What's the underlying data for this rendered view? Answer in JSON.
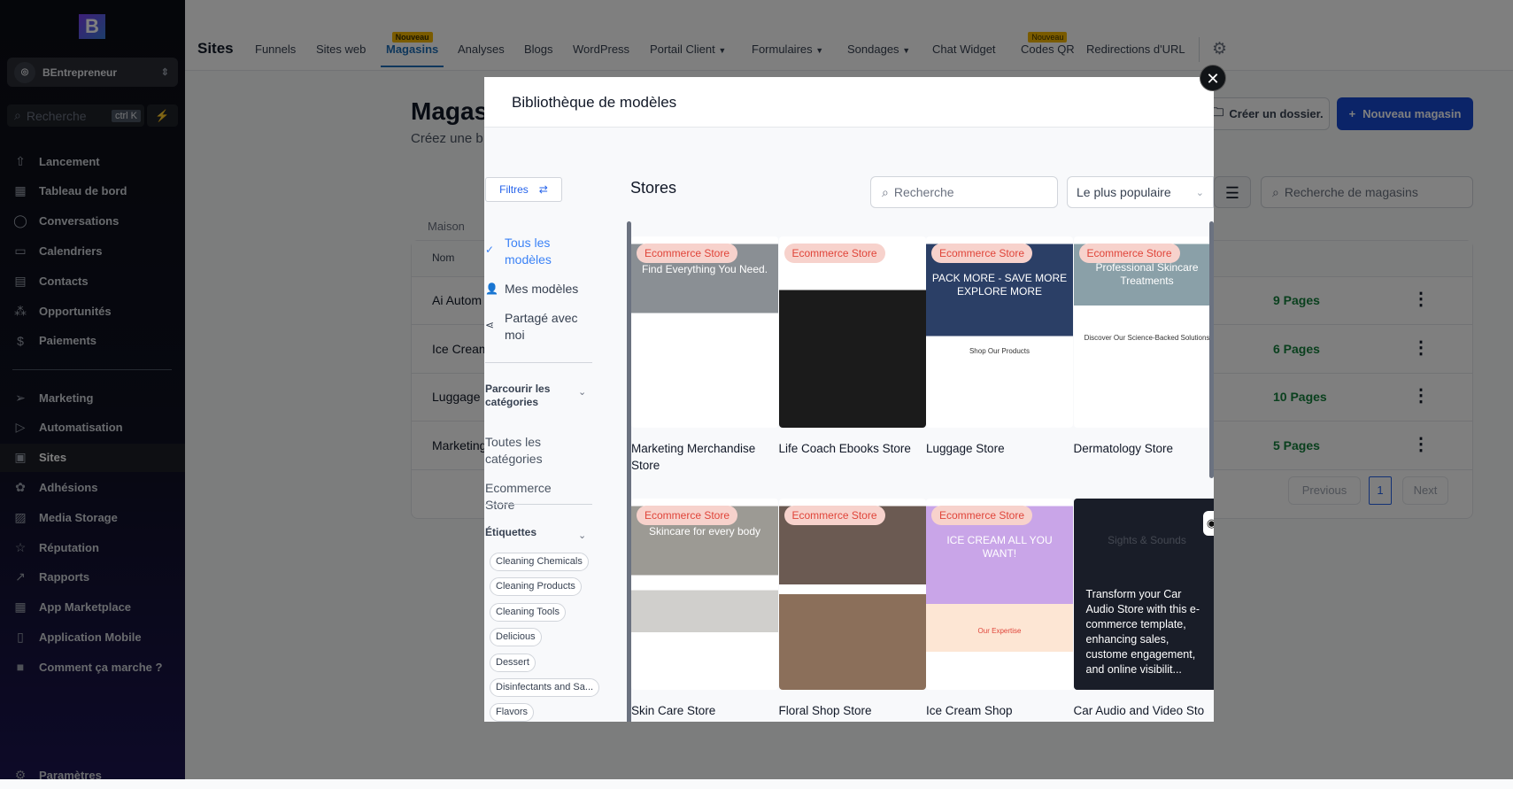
{
  "sidebar": {
    "logo": "B",
    "account": "BEntrepreneur",
    "search_placeholder": "Recherche",
    "shortcut": "ctrl K",
    "items": [
      {
        "label": "Lancement",
        "icon": "rocket-icon"
      },
      {
        "label": "Tableau de bord",
        "icon": "dashboard-icon"
      },
      {
        "label": "Conversations",
        "icon": "chat-icon"
      },
      {
        "label": "Calendriers",
        "icon": "calendar-icon"
      },
      {
        "label": "Contacts",
        "icon": "contacts-icon"
      },
      {
        "label": "Opportunités",
        "icon": "opportunities-icon"
      },
      {
        "label": "Paiements",
        "icon": "payments-icon"
      },
      {
        "label": "Marketing",
        "icon": "send-icon"
      },
      {
        "label": "Automatisation",
        "icon": "automation-icon"
      },
      {
        "label": "Sites",
        "icon": "sites-icon",
        "active": true
      },
      {
        "label": "Adhésions",
        "icon": "badge-icon"
      },
      {
        "label": "Media Storage",
        "icon": "image-icon"
      },
      {
        "label": "Réputation",
        "icon": "star-icon"
      },
      {
        "label": "Rapports",
        "icon": "chart-icon"
      },
      {
        "label": "App Marketplace",
        "icon": "apps-icon"
      },
      {
        "label": "Application Mobile",
        "icon": "mobile-icon"
      },
      {
        "label": "Comment ça marche ?",
        "icon": "video-icon"
      }
    ],
    "settings": "Paramètres"
  },
  "topnav": {
    "title": "Sites",
    "items": [
      "Funnels",
      "Sites web",
      "Magasins",
      "Analyses",
      "Blogs",
      "WordPress",
      "Portail Client",
      "Formulaires",
      "Sondages",
      "Chat Widget",
      "Codes QR",
      "Redirections d'URL"
    ],
    "badge": "Nouveau",
    "active": "Magasins"
  },
  "page": {
    "title": "Magasins",
    "subtitle": "Créez une b",
    "create_folder": "Créer un dossier.",
    "new_store": "Nouveau magasin",
    "search_placeholder": "Recherche de magasins",
    "breadcrumb": "Maison",
    "col_name": "Nom",
    "rows": [
      {
        "name": "Ai Autom",
        "pages": "9 Pages"
      },
      {
        "name": "Ice Cream",
        "pages": "6 Pages"
      },
      {
        "name": "Luggage",
        "pages": "10 Pages"
      },
      {
        "name": "Marketing",
        "pages": "5 Pages"
      }
    ],
    "pagination": {
      "previous": "Previous",
      "current": "1",
      "next": "Next"
    }
  },
  "modal": {
    "title": "Bibliothèque de modèles",
    "filters": "Filtres",
    "nav": {
      "all": "Tous les modèles",
      "mine": "Mes modèles",
      "shared": "Partagé avec moi"
    },
    "browse_label": "Parcourir les catégories",
    "categories": [
      "Toutes les catégories",
      "Ecommerce Store"
    ],
    "tags_label": "Étiquettes",
    "tags": [
      "Cleaning Chemicals",
      "Cleaning Products",
      "Cleaning Tools",
      "Delicious",
      "Dessert",
      "Disinfectants and Sa...",
      "Flavors"
    ],
    "section_title": "Stores",
    "search_placeholder": "Recherche",
    "sort": "Le plus populaire",
    "cards": [
      {
        "title": "Marketing Merchandise Store",
        "badge": "Ecommerce Store",
        "hero": "Find Everything You Need."
      },
      {
        "title": "Life Coach Ebooks Store",
        "badge": "Ecommerce Store"
      },
      {
        "title": "Luggage Store",
        "badge": "Ecommerce Store",
        "hero": "PACK MORE - SAVE MORE EXPLORE MORE",
        "sub": "Shop Our Products"
      },
      {
        "title": "Dermatology Store",
        "badge": "Ecommerce Store",
        "hero": "Professional Skincare Treatments",
        "sub": "Discover Our Science-Backed Solutions"
      },
      {
        "title": "Skin Care Store",
        "badge": "Ecommerce Store",
        "hero": "Skincare for every body"
      },
      {
        "title": "Floral Shop Store",
        "badge": "Ecommerce Store"
      },
      {
        "title": "Ice Cream Shop",
        "badge": "Ecommerce Store",
        "hero": "ICE CREAM ALL YOU WANT!",
        "sub": "Our Expertise"
      },
      {
        "title": "Car Audio and Video Sto",
        "description": "Transform your Car Audio Store with this e-commerce template, enhancing sales, custome engagement, and online visibilit...",
        "hero": "Sights & Sounds"
      }
    ]
  }
}
